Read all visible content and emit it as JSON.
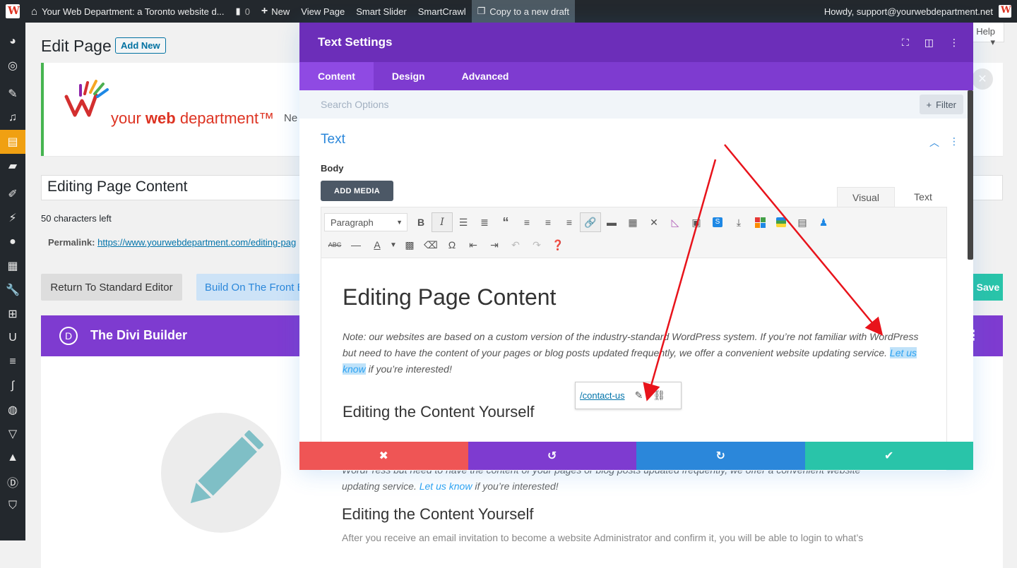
{
  "adminbar": {
    "site_title": "Your Web Department: a Toronto website d...",
    "comments_count": "0",
    "new_label": "New",
    "view_page": "View Page",
    "smart_slider": "Smart Slider",
    "smartcrawl": "SmartCrawl",
    "copy_draft": "Copy to a new draft",
    "howdy": "Howdy, support@yourwebdepartment.net"
  },
  "page": {
    "title": "Edit Page",
    "add_new": "Add New",
    "help": "Help",
    "logo_text_plain": "your ",
    "logo_text_bold": "web",
    "logo_text_rest": " department™",
    "notice_partial": "Ne",
    "post_title": "Editing Page Content",
    "chars_left": "50 characters left",
    "permalink_label": "Permalink:",
    "permalink_url": "https://www.yourwebdepartment.com/editing-pag",
    "btn_standard": "Return To Standard Editor",
    "btn_front": "Build On The Front E",
    "btn_save": "Save",
    "divi_logo": "D",
    "divi_title": "The Divi Builder",
    "bg_text_1": "WordPress but need to have the content of your pages or blog posts updated frequently, we offer a convenient website",
    "bg_text_2a": "updating service. ",
    "bg_text_2link": "Let us know",
    "bg_text_2b": " if you’re interested!",
    "bg_heading": "Editing the Content Yourself",
    "bg_para": "After you receive an email invitation to become a website Administrator and confirm it, you will be able to login to what’s"
  },
  "modal": {
    "title": "Text Settings",
    "tabs": [
      "Content",
      "Design",
      "Advanced"
    ],
    "search_placeholder": "Search Options",
    "filter": "Filter",
    "section_title": "Text",
    "body_label": "Body",
    "add_media": "ADD MEDIA",
    "tab_visual": "Visual",
    "tab_text": "Text",
    "paragraph_select": "Paragraph",
    "editor_h1": "Editing Page Content",
    "editor_p_before": "Note: our websites are based on a custom version of the industry-standard WordPress system. If you’re not familiar with WordPress but need to have the content of your pages or blog posts updated frequently, we offer a convenient website updating service. ",
    "editor_p_link": "Let us know",
    "editor_p_after": " if you’re interested!",
    "editor_h2": "Editing the Content Yourself",
    "link_popup_url": "/contact-us"
  },
  "colors": {
    "purple_dark": "#6c2eb9",
    "purple": "#7e3bd0",
    "blue": "#2b87da",
    "red": "#ef5555",
    "green": "#29c4a9",
    "orange": "#f0a012"
  }
}
